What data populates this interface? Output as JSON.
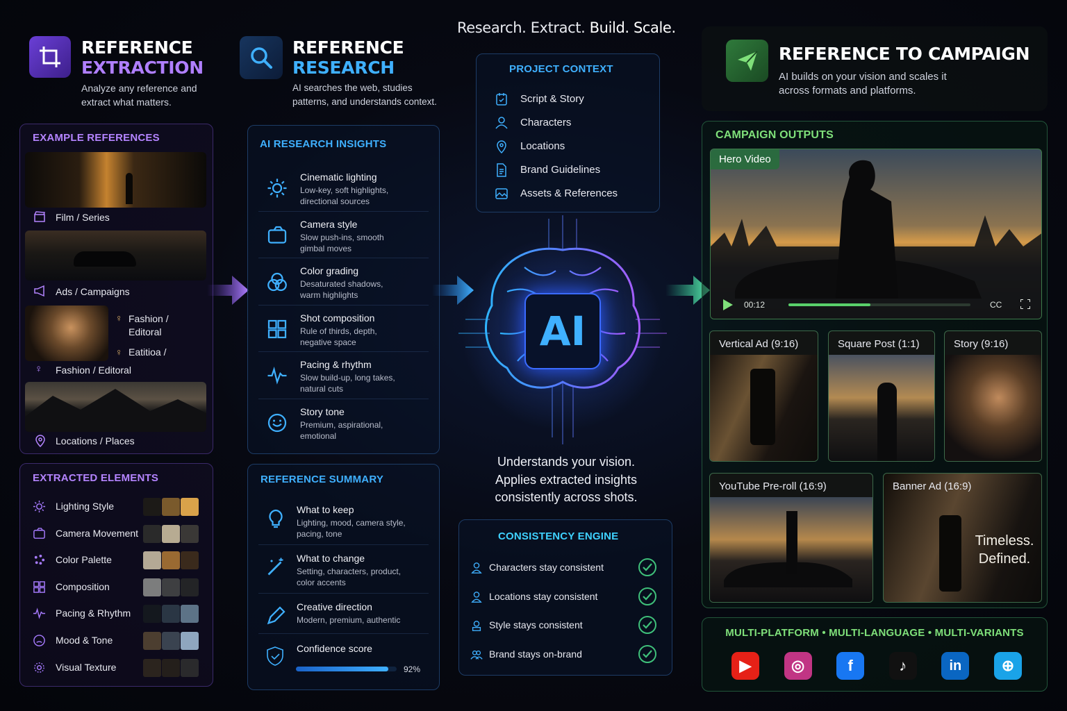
{
  "tagline": {
    "research": "Research.",
    "extract": "Extract.",
    "build": "Build.",
    "scale": "Scale."
  },
  "extraction": {
    "title_line1": "REFERENCE",
    "title_line2": "EXTRACTION",
    "subtitle": "Analyze any reference and extract what matters.",
    "examples_title": "EXAMPLE REFERENCES",
    "examples": [
      {
        "label": "Film / Series",
        "icon": "clapperboard-icon"
      },
      {
        "label": "Ads / Campaigns",
        "icon": "megaphone-icon"
      },
      {
        "label": "Fashion / Editoral",
        "icon": "dress-icon"
      },
      {
        "label": "Locations / Places",
        "icon": "map-pin-icon"
      }
    ],
    "fashion_overlay_1": "Fashion / Editoral",
    "fashion_overlay_2": "Eatitioa /",
    "elements_title": "EXTRACTED ELEMENTS",
    "elements": [
      {
        "label": "Lighting Style",
        "icon": "sun-icon",
        "swatches": [
          "#1c1a17",
          "#7a5a2c",
          "#d9a24a"
        ]
      },
      {
        "label": "Camera Movement",
        "icon": "camera-icon",
        "swatches": [
          "#2a2a2a",
          "#b7ab92",
          "#3a3836"
        ]
      },
      {
        "label": "Color Palette",
        "icon": "palette-icon",
        "swatches": [
          "#b4a995",
          "#9a6a32",
          "#3a2a1c"
        ]
      },
      {
        "label": "Composition",
        "icon": "grid-icon",
        "swatches": [
          "#7c7d7d",
          "#3e3f41",
          "#232426"
        ]
      },
      {
        "label": "Pacing & Rhythm",
        "icon": "pulse-icon",
        "swatches": [
          "#14181e",
          "#2a3644",
          "#5d7387"
        ]
      },
      {
        "label": "Mood & Tone",
        "icon": "mood-icon",
        "swatches": [
          "#4c3e30",
          "#3a4350",
          "#8fa6bf"
        ]
      },
      {
        "label": "Visual Texture",
        "icon": "texture-icon",
        "swatches": [
          "#2b241e",
          "#241f1b",
          "#2a2a2c"
        ]
      }
    ]
  },
  "research": {
    "title_line1": "REFERENCE",
    "title_line2": "RESEARCH",
    "subtitle": "AI searches the web, studies patterns, and understands context.",
    "insights_title": "AI RESEARCH INSIGHTS",
    "insights": [
      {
        "title": "Cinematic lighting",
        "desc": "Low-key, soft highlights, directional sources",
        "icon": "sun-icon"
      },
      {
        "title": "Camera style",
        "desc": "Slow push-ins, smooth gimbal moves",
        "icon": "camera-icon"
      },
      {
        "title": "Color grading",
        "desc": "Desaturated shadows, warm highlights",
        "icon": "color-grading-icon"
      },
      {
        "title": "Shot composition",
        "desc": "Rule of thirds, depth, negative space",
        "icon": "grid-icon"
      },
      {
        "title": "Pacing & rhythm",
        "desc": "Slow build-up, long takes, natural cuts",
        "icon": "pulse-icon"
      },
      {
        "title": "Story tone",
        "desc": "Premium, aspirational, emotional",
        "icon": "smile-icon"
      }
    ],
    "summary_title": "REFERENCE SUMMARY",
    "summary": [
      {
        "title": "What to keep",
        "desc": "Lighting, mood, camera style, pacing, tone",
        "icon": "bulb-icon"
      },
      {
        "title": "What to change",
        "desc": "Setting, characters, product, color accents",
        "icon": "wand-icon"
      },
      {
        "title": "Creative direction",
        "desc": "Modern, premium, authentic",
        "icon": "pen-icon"
      }
    ],
    "confidence_label": "Confidence score",
    "confidence_value": 0.92,
    "confidence_text": "92%"
  },
  "context": {
    "title": "PROJECT CONTEXT",
    "items": [
      {
        "label": "Script & Story",
        "icon": "script-icon"
      },
      {
        "label": "Characters",
        "icon": "characters-icon"
      },
      {
        "label": "Locations",
        "icon": "map-pin-icon"
      },
      {
        "label": "Brand Guidelines",
        "icon": "document-icon"
      },
      {
        "label": "Assets & References",
        "icon": "image-icon"
      }
    ]
  },
  "ai": {
    "badge": "AI",
    "caption_1": "Understands your vision.",
    "caption_2": "Applies extracted insights",
    "caption_3": "consistently across shots."
  },
  "engine": {
    "title": "CONSISTENCY ENGINE",
    "items": [
      {
        "label": "Characters stay consistent",
        "icon": "person-icon"
      },
      {
        "label": "Locations stay consistent",
        "icon": "person-icon"
      },
      {
        "label": "Style stays consistent",
        "icon": "style-icon"
      },
      {
        "label": "Brand stays on-brand",
        "icon": "group-icon"
      }
    ]
  },
  "campaign": {
    "title": "REFERENCE TO CAMPAIGN",
    "subtitle": "AI builds on your vision and scales it across formats and platforms.",
    "outputs_title": "CAMPAIGN OUTPUTS",
    "hero_label": "Hero Video",
    "timecode": "00:12",
    "progress": 0.45,
    "cc": "CC",
    "formats": [
      {
        "label": "Vertical Ad (9:16)"
      },
      {
        "label": "Square Post (1:1)"
      },
      {
        "label": "Story (9:16)"
      },
      {
        "label": "YouTube Pre-roll (16:9)"
      },
      {
        "label": "Banner Ad (16:9)"
      }
    ],
    "banner_text_1": "Timeless.",
    "banner_text_2": "Defined.",
    "multi": "MULTI-PLATFORM • MULTI-LANGUAGE • MULTI-VARIANTS",
    "platforms": [
      {
        "name": "youtube-icon",
        "color": "#e62117"
      },
      {
        "name": "instagram-icon",
        "color": "#c13584"
      },
      {
        "name": "facebook-icon",
        "color": "#1877f2"
      },
      {
        "name": "tiktok-icon",
        "color": "#111111"
      },
      {
        "name": "linkedin-icon",
        "color": "#0a66c2"
      },
      {
        "name": "globe-icon",
        "color": "#1aa3e8"
      }
    ]
  },
  "colors": {
    "purple": "#a77bff",
    "blue": "#3fb0ff",
    "green": "#7fe07a",
    "cyan": "#4fd2ff"
  }
}
